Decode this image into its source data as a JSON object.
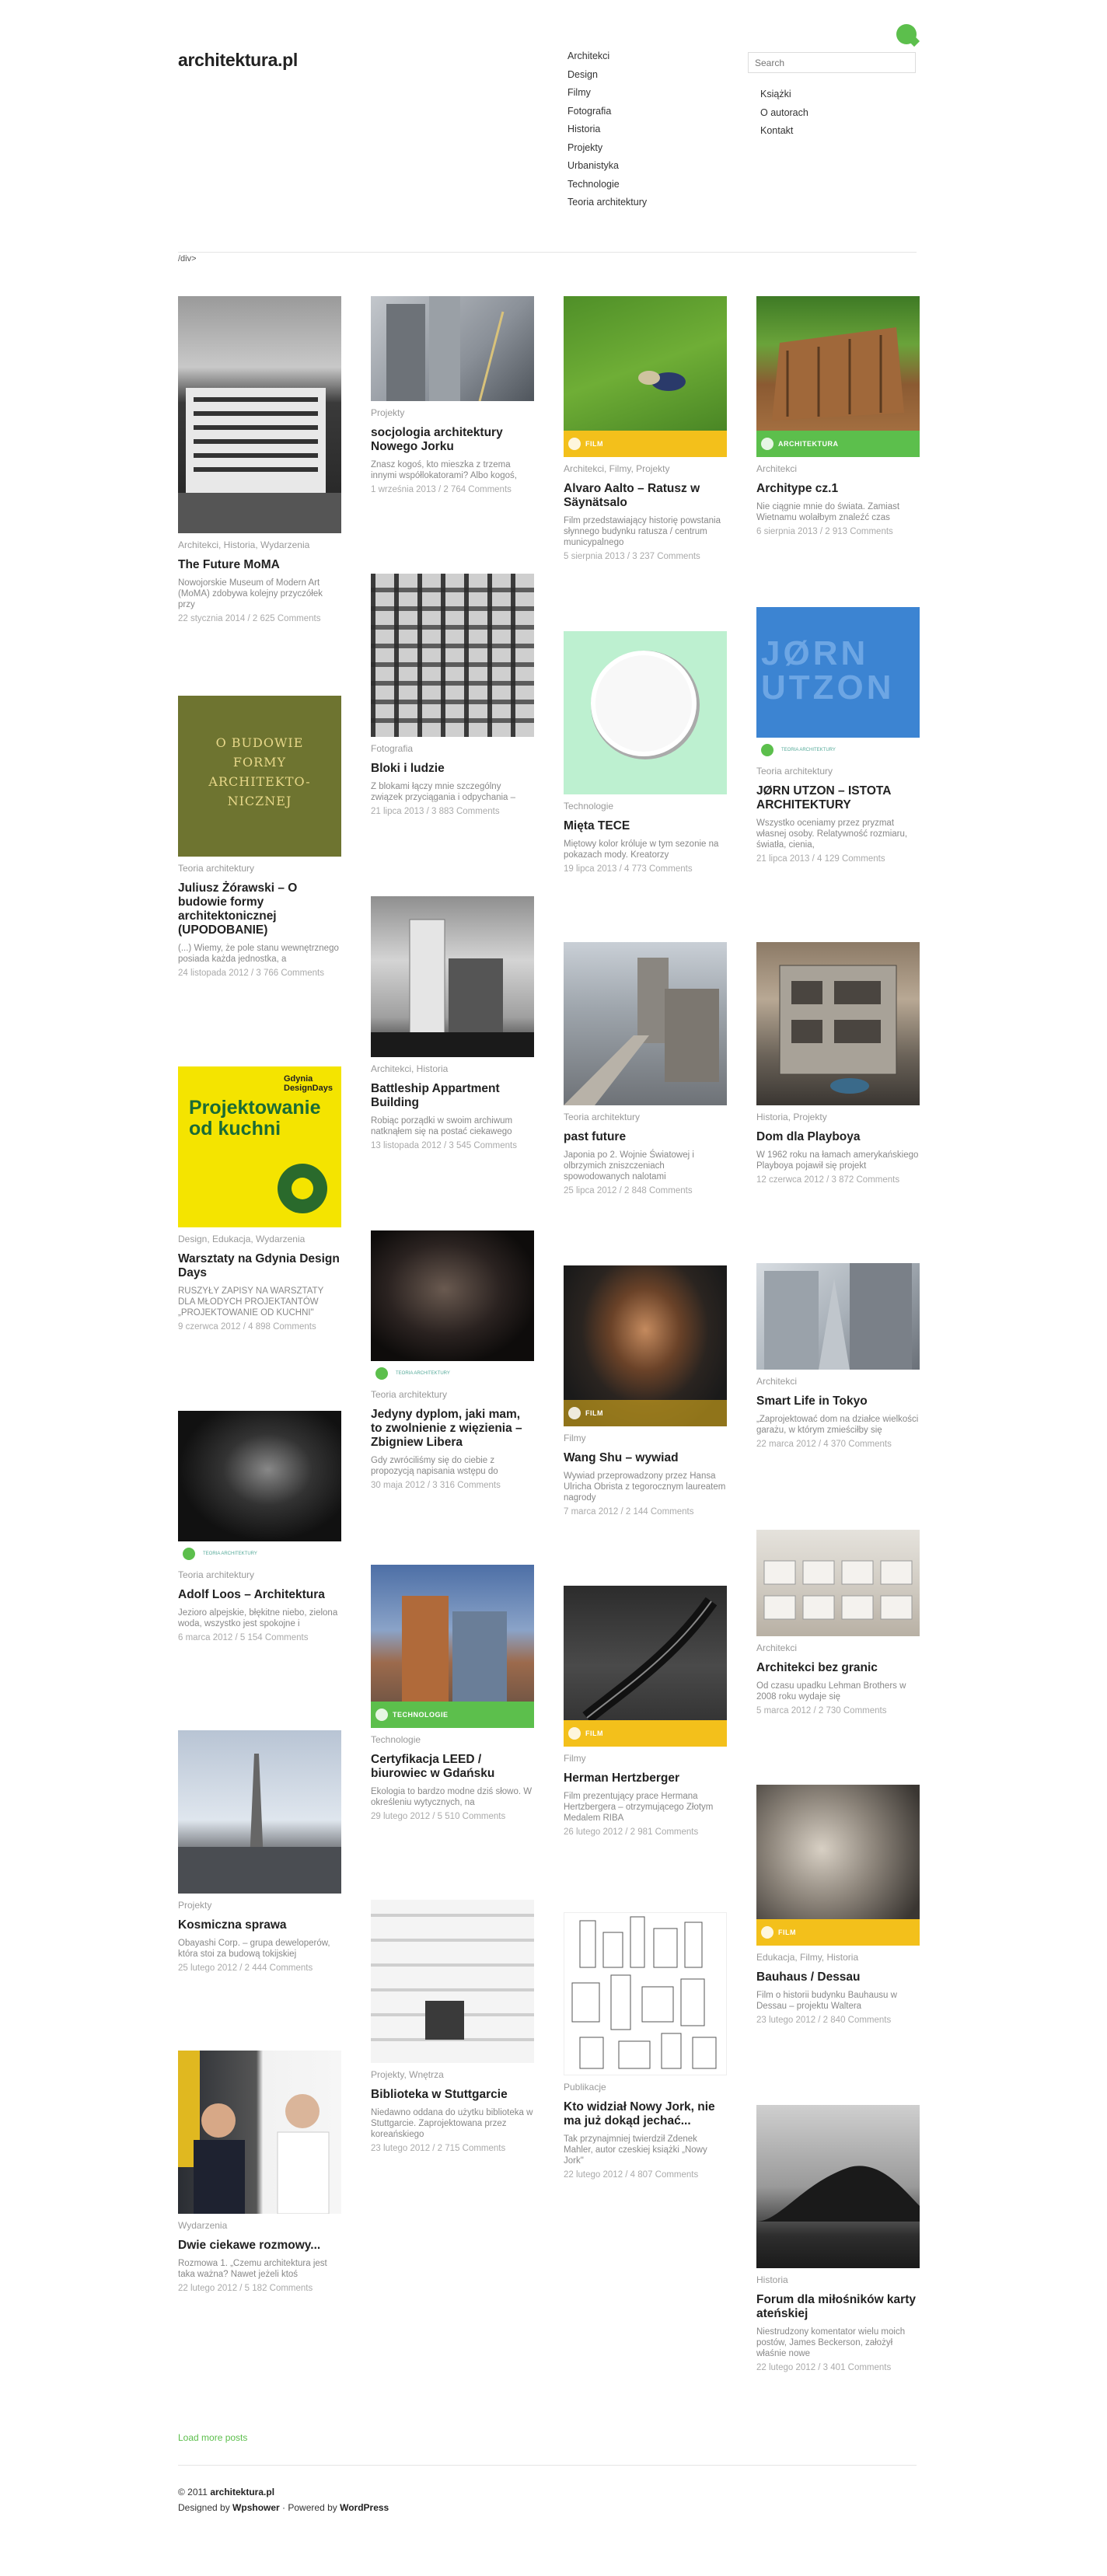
{
  "site": {
    "logo": "architektura.pl"
  },
  "nav_main": [
    "Architekci",
    "Design",
    "Filmy",
    "Fotografia",
    "Historia",
    "Projekty",
    "Urbanistyka",
    "Technologie",
    "Teoria architektury"
  ],
  "search": {
    "placeholder": "Search"
  },
  "nav_side": [
    "Książki",
    "O autorach",
    "Kontakt"
  ],
  "stray_text": "/div>",
  "posts": [
    {
      "cat": "Architekci, Historia, Wydarzenia",
      "title": "The Future MoMA",
      "excerpt": "Nowojorskie Museum of Modern Art (MoMA) zdobywa kolejny przyczółek przy",
      "meta": "22 stycznia 2014 / 2 625 Comments"
    },
    {
      "cat": "Teoria architektury",
      "title": "Juliusz Żórawski – O budowie formy architektonicznej (UPODOBANIE)",
      "excerpt": "(...) Wiemy, że pole stanu wewnętrznego posiada każda jednostka, a",
      "meta": "24 listopada 2012 / 3 766 Comments",
      "thumb_text": "O BUDOWIE FORMY ARCHITEKTO-NICZNEJ"
    },
    {
      "cat": "Design, Edukacja, Wydarzenia",
      "title": "Warsztaty na Gdynia Design Days",
      "excerpt": "RUSZYŁY ZAPISY NA WARSZTATY DLA MŁODYCH PROJEKTANTÓW „PROJEKTOWANIE OD KUCHNI\"",
      "meta": "9 czerwca 2012 / 4 898 Comments",
      "thumb_text": "Projektowanie od kuchni",
      "thumb_brand": "Gdynia DesignDays"
    },
    {
      "cat": "Teoria architektury",
      "title": "Adolf Loos – Architektura",
      "excerpt": "Jezioro alpejskie, błękitne niebo, zielona woda, wszystko jest spokojne i",
      "meta": "6 marca 2012 / 5 154 Comments",
      "strip": "TEORIA ARCHITEKTURY"
    },
    {
      "cat": "Projekty",
      "title": "Kosmiczna sprawa",
      "excerpt": "Obayashi Corp. – grupa deweloperów, która stoi za budową tokijskiej",
      "meta": "25 lutego 2012 / 2 444 Comments"
    },
    {
      "cat": "Wydarzenia",
      "title": "Dwie ciekawe rozmowy...",
      "excerpt": "Rozmowa 1. „Czemu architektura jest taka ważna? Nawet jeżeli ktoś",
      "meta": "22 lutego 2012 / 5 182 Comments"
    },
    {
      "cat": "Projekty",
      "title": "socjologia architektury Nowego Jorku",
      "excerpt": "Znasz kogoś, kto mieszka z trzema innymi współlokatorami? Albo kogoś,",
      "meta": "1 września 2013 / 2 764 Comments"
    },
    {
      "cat": "Fotografia",
      "title": "Bloki i ludzie",
      "excerpt": "Z blokami łączy mnie szczególny związek przyciągania i odpychania –",
      "meta": "21 lipca 2013 / 3 883 Comments"
    },
    {
      "cat": "Architekci, Historia",
      "title": "Battleship Appartment Building",
      "excerpt": "Robiąc porządki w swoim archiwum natknąłem się na postać ciekawego",
      "meta": "13 listopada 2012 / 3 545 Comments"
    },
    {
      "cat": "Teoria architektury",
      "title": "Jedyny dyplom, jaki mam, to zwolnienie z więzienia – Zbigniew Libera",
      "excerpt": "Gdy zwróciliśmy się do ciebie z propozycją napisania wstępu do",
      "meta": "30 maja 2012 / 3 316 Comments",
      "strip": "TEORIA ARCHITEKTURY"
    },
    {
      "cat": "Technologie",
      "title": "Certyfikacja LEED / biurowiec w Gdańsku",
      "excerpt": "Ekologia to bardzo modne dziś słowo. W określeniu wytycznych, na",
      "meta": "29 lutego 2012 / 5 510 Comments",
      "badge": "TECHNOLOGIE"
    },
    {
      "cat": "Projekty, Wnętrza",
      "title": "Biblioteka w Stuttgarcie",
      "excerpt": "Niedawno oddana do użytku biblioteka w Stuttgarcie. Zaprojektowana przez koreańskiego",
      "meta": "23 lutego 2012 / 2 715 Comments"
    },
    {
      "cat": "Architekci, Filmy, Projekty",
      "title": "Alvaro Aalto – Ratusz w Säynätsalo",
      "excerpt": "Film przedstawiający historię powstania słynnego budynku ratusza / centrum municypalnego",
      "meta": "5 sierpnia 2013 / 3 237 Comments",
      "badge": "FILM"
    },
    {
      "cat": "Technologie",
      "title": "Mięta TECE",
      "excerpt": "Miętowy kolor króluje w tym sezonie na pokazach mody. Kreatorzy",
      "meta": "19 lipca 2013 / 4 773 Comments"
    },
    {
      "cat": "Teoria architektury",
      "title": "past future",
      "excerpt": "Japonia po 2. Wojnie Światowej i olbrzymich zniszczeniach spowodowanych nalotami",
      "meta": "25 lipca 2012 / 2 848 Comments"
    },
    {
      "cat": "Filmy",
      "title": "Wang Shu – wywiad",
      "excerpt": "Wywiad przeprowadzony przez Hansa Ulricha Obrista z tegorocznym laureatem nagrody",
      "meta": "7 marca 2012 / 2 144 Comments",
      "badge": "FILM"
    },
    {
      "cat": "Filmy",
      "title": "Herman Hertzberger",
      "excerpt": "Film prezentujący prace Hermana Hertzbergera – otrzymującego Złotym Medalem RIBA",
      "meta": "26 lutego 2012 / 2 981 Comments",
      "badge": "FILM"
    },
    {
      "cat": "Publikacje",
      "title": "Kto widział Nowy Jork, nie ma już dokąd jechać...",
      "excerpt": "Tak przynajmniej twierdził Zdenek Mahler, autor czeskiej książki „Nowy Jork\"",
      "meta": "22 lutego 2012 / 4 807 Comments"
    },
    {
      "cat": "Architekci",
      "title": "Architype cz.1",
      "excerpt": "Nie ciągnie mnie do świata. Zamiast Wietnamu wolałbym znaleźć czas",
      "meta": "6 sierpnia 2013 / 2 913 Comments",
      "badge": "ARCHITEKTURA"
    },
    {
      "cat": "Teoria architektury",
      "title": "JØRN UTZON – ISTOTA ARCHITEKTURY",
      "excerpt": "Wszystko oceniamy przez pryzmat własnej osoby. Relatywność rozmiaru, światła, cienia,",
      "meta": "21 lipca 2013 / 4 129 Comments",
      "thumb_text": "JØRN UTZON",
      "strip": "TEORIA ARCHITEKTURY"
    },
    {
      "cat": "Historia, Projekty",
      "title": "Dom dla Playboya",
      "excerpt": "W 1962 roku na łamach amerykańskiego Playboya pojawił się projekt",
      "meta": "12 czerwca 2012 / 3 872 Comments"
    },
    {
      "cat": "Architekci",
      "title": "Smart Life in Tokyo",
      "excerpt": "„Zaprojektować dom na działce wielkości garażu, w którym zmieściłby się",
      "meta": "22 marca 2012 / 4 370 Comments"
    },
    {
      "cat": "Architekci",
      "title": "Architekci bez granic",
      "excerpt": "Od czasu upadku Lehman Brothers w 2008 roku wydaje się",
      "meta": "5 marca 2012 / 2 730 Comments"
    },
    {
      "cat": "Edukacja, Filmy, Historia",
      "title": "Bauhaus / Dessau",
      "excerpt": "Film o historii budynku Bauhausu w Dessau – projektu Waltera",
      "meta": "23 lutego 2012 / 2 840 Comments",
      "badge": "FILM"
    },
    {
      "cat": "Historia",
      "title": "Forum dla miłośników karty ateńskiej",
      "excerpt": "Niestrudzony komentator wielu moich postów, James Beckerson, założył właśnie nowe",
      "meta": "22 lutego 2012 / 3 401 Comments"
    }
  ],
  "load_more": "Load more posts",
  "footer": {
    "copyright": "© 2011 ",
    "site": "architektura.pl",
    "designed_by": "Designed by ",
    "designer": "Wpshower",
    "powered_by": " · Powered by ",
    "platform": "WordPress"
  }
}
